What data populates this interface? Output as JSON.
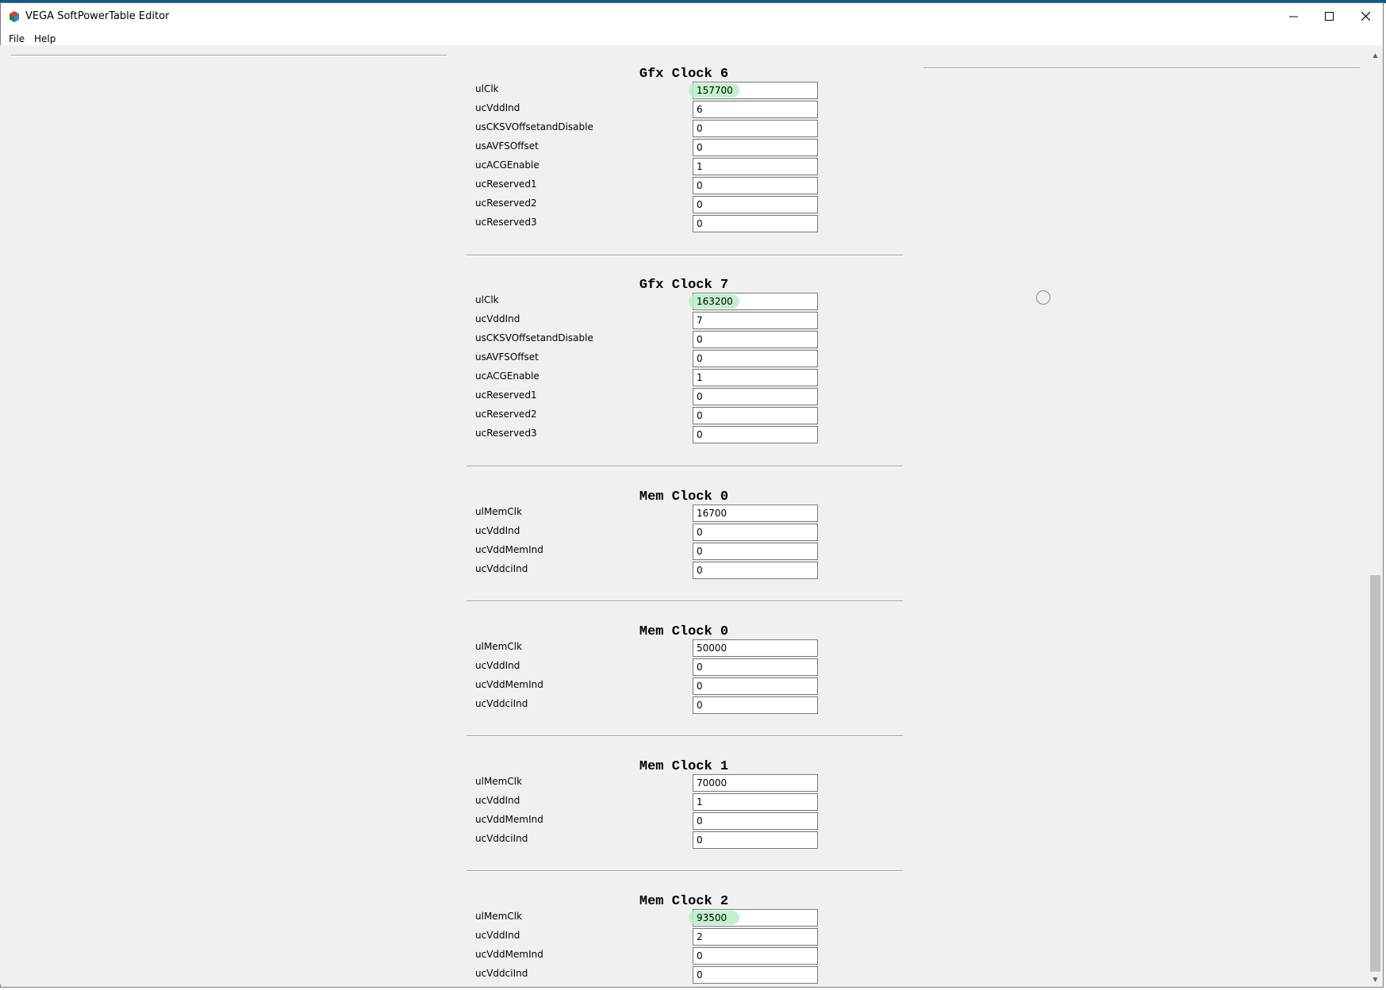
{
  "window": {
    "title": "VEGA SoftPowerTable Editor"
  },
  "menu": {
    "file": "File",
    "help": "Help"
  },
  "sections": [
    {
      "title": "Gfx Clock 6",
      "fields": [
        {
          "label": "ulClk",
          "value": "157700"
        },
        {
          "label": "ucVddInd",
          "value": "6"
        },
        {
          "label": "usCKSVOffsetandDisable",
          "value": "0"
        },
        {
          "label": "usAVFSOffset",
          "value": "0"
        },
        {
          "label": "ucACGEnable",
          "value": "1"
        },
        {
          "label": "ucReserved1",
          "value": "0"
        },
        {
          "label": "ucReserved2",
          "value": "0"
        },
        {
          "label": "ucReserved3",
          "value": "0"
        }
      ]
    },
    {
      "title": "Gfx Clock 7",
      "fields": [
        {
          "label": "ulClk",
          "value": "163200"
        },
        {
          "label": "ucVddInd",
          "value": "7"
        },
        {
          "label": "usCKSVOffsetandDisable",
          "value": "0"
        },
        {
          "label": "usAVFSOffset",
          "value": "0"
        },
        {
          "label": "ucACGEnable",
          "value": "1"
        },
        {
          "label": "ucReserved1",
          "value": "0"
        },
        {
          "label": "ucReserved2",
          "value": "0"
        },
        {
          "label": "ucReserved3",
          "value": "0"
        }
      ]
    },
    {
      "title": "Mem Clock 0",
      "fields": [
        {
          "label": "ulMemClk",
          "value": "16700"
        },
        {
          "label": "ucVddInd",
          "value": "0"
        },
        {
          "label": "ucVddMemInd",
          "value": "0"
        },
        {
          "label": "ucVddciInd",
          "value": "0"
        }
      ]
    },
    {
      "title": "Mem Clock 0",
      "fields": [
        {
          "label": "ulMemClk",
          "value": "50000"
        },
        {
          "label": "ucVddInd",
          "value": "0"
        },
        {
          "label": "ucVddMemInd",
          "value": "0"
        },
        {
          "label": "ucVddciInd",
          "value": "0"
        }
      ]
    },
    {
      "title": "Mem Clock 1",
      "fields": [
        {
          "label": "ulMemClk",
          "value": "70000"
        },
        {
          "label": "ucVddInd",
          "value": "1"
        },
        {
          "label": "ucVddMemInd",
          "value": "0"
        },
        {
          "label": "ucVddciInd",
          "value": "0"
        }
      ]
    },
    {
      "title": "Mem Clock 2",
      "fields": [
        {
          "label": "ulMemClk",
          "value": "93500"
        },
        {
          "label": "ucVddInd",
          "value": "2"
        },
        {
          "label": "ucVddMemInd",
          "value": "0"
        },
        {
          "label": "ucVddciInd",
          "value": "0"
        }
      ]
    }
  ],
  "colors": {
    "highlight": "#b8efc4",
    "background": "#f0f0f0"
  }
}
